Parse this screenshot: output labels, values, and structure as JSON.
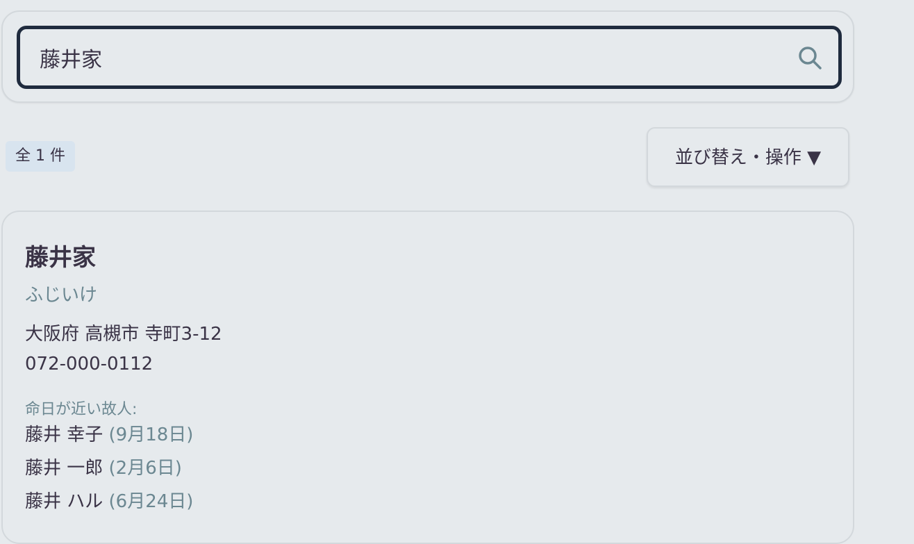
{
  "search": {
    "value": "藤井家",
    "icon": "search-icon"
  },
  "results": {
    "count_label": "全 1 件",
    "sort_button_label": "並び替え・操作 ▼"
  },
  "card": {
    "title": "藤井家",
    "kana": "ふじいけ",
    "address": "大阪府 高槻市 寺町3-12",
    "phone": "072-000-0112",
    "section_label": "命日が近い故人:",
    "deceased": [
      {
        "name": "藤井 幸子",
        "date": "(9月18日)"
      },
      {
        "name": "藤井 一郎",
        "date": "(2月6日)"
      },
      {
        "name": "藤井 ハル",
        "date": "(6月24日)"
      }
    ]
  },
  "colors": {
    "background": "#e6eaed",
    "input_border": "#1f2b3e",
    "badge_bg": "#d8e4ef",
    "muted_text": "#6b8791",
    "primary_text": "#3a3346"
  }
}
